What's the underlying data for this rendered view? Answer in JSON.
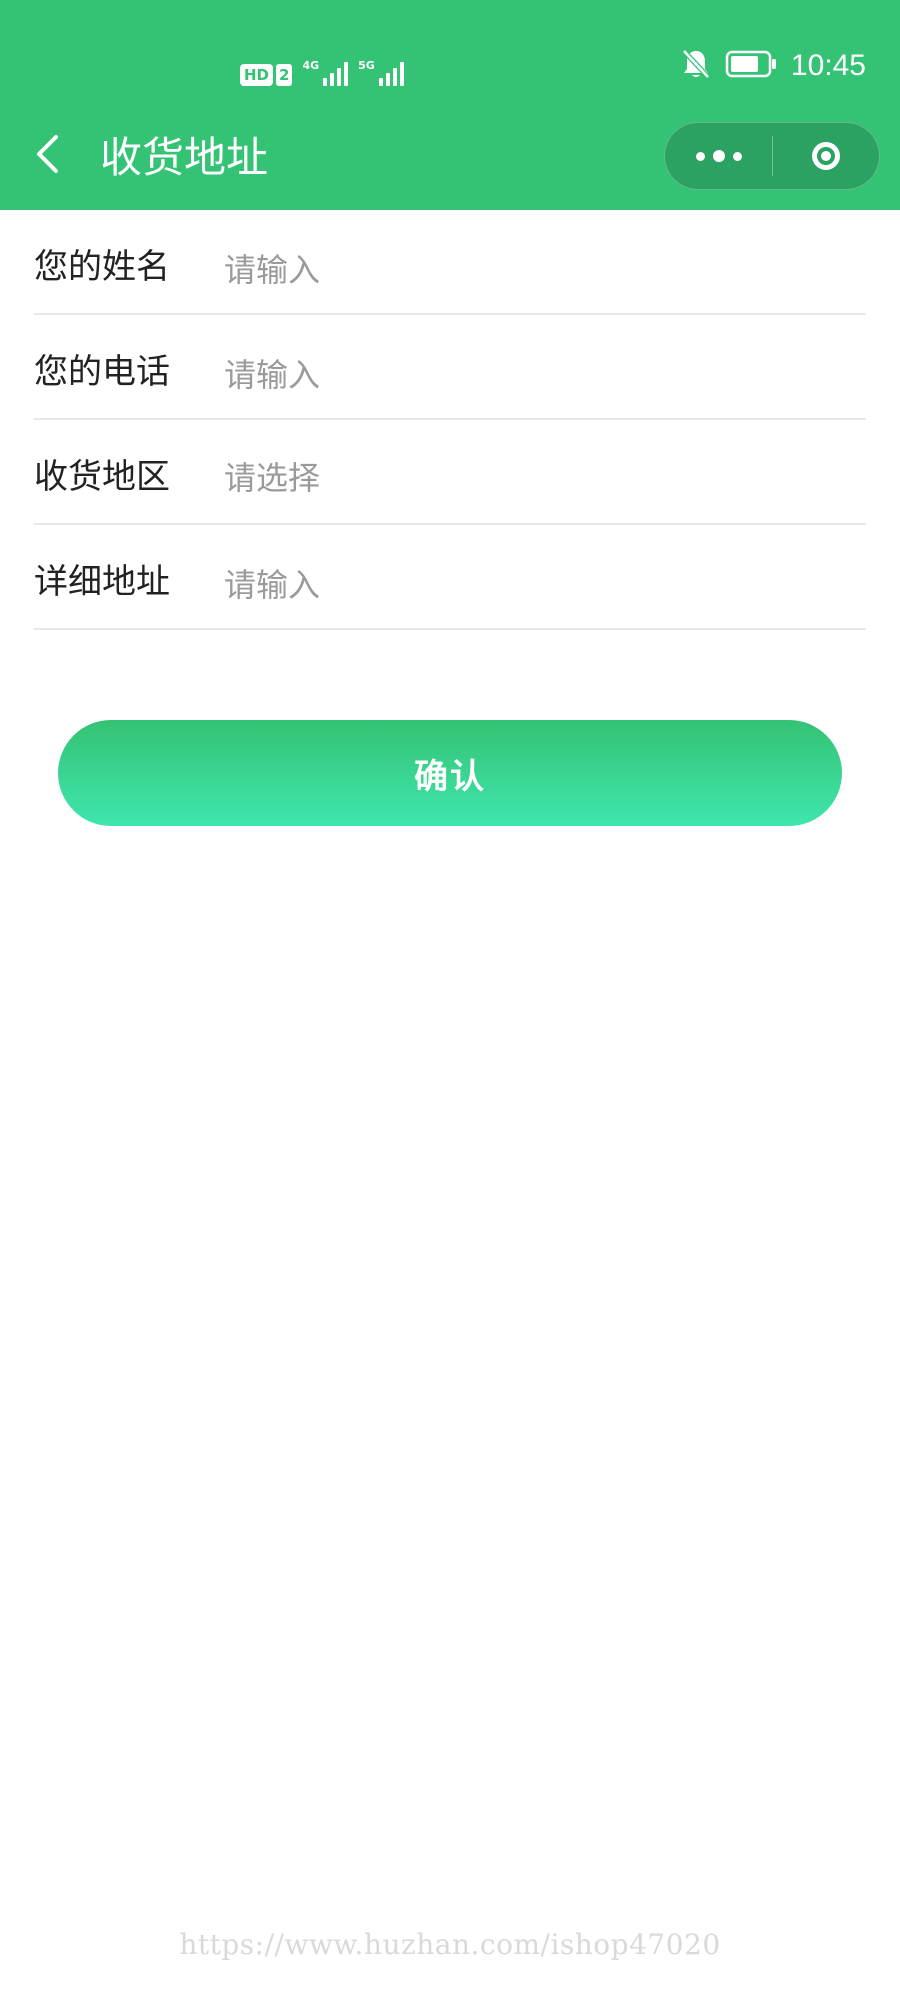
{
  "status_bar": {
    "hd_label": "HD",
    "hd_sim": "2",
    "network_1": "4G",
    "network_2": "5G",
    "time": "10:45",
    "icons": [
      "bell-muted-icon",
      "battery-icon"
    ]
  },
  "nav": {
    "back_icon": "chevron-left-icon",
    "title": "收货地址",
    "capsule_more_icon": "more-dots-icon",
    "capsule_close_icon": "target-circle-icon"
  },
  "form": {
    "name": {
      "label": "您的姓名",
      "placeholder": "请输入",
      "value": ""
    },
    "phone": {
      "label": "您的电话",
      "placeholder": "请输入",
      "value": ""
    },
    "region": {
      "label": "收货地区",
      "placeholder": "请选择"
    },
    "address": {
      "label": "详细地址",
      "placeholder": "请输入",
      "value": ""
    }
  },
  "confirm_label": "确认",
  "watermark": "https://www.huzhan.com/ishop47020",
  "colors": {
    "brand_green": "#34c274",
    "button_gradient_end": "#3fe6ad",
    "divider": "#e8e8e8",
    "placeholder": "#9a9a9a"
  }
}
